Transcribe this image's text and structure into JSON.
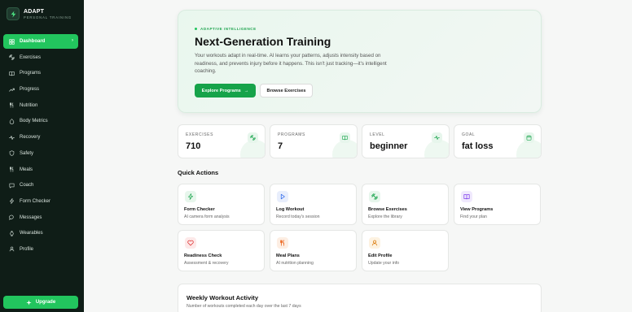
{
  "brand": {
    "name": "ADAPT",
    "subtitle": "PERSONAL TRAINING",
    "logo_icon": "bolt-icon"
  },
  "sidebar": {
    "items": [
      {
        "label": "Dashboard",
        "icon": "grid-icon",
        "active": true
      },
      {
        "label": "Exercises",
        "icon": "dumbbell-icon"
      },
      {
        "label": "Programs",
        "icon": "book-icon"
      },
      {
        "label": "Progress",
        "icon": "trend-icon"
      },
      {
        "label": "Nutrition",
        "icon": "utensils-icon"
      },
      {
        "label": "Body Metrics",
        "icon": "scale-icon"
      },
      {
        "label": "Recovery",
        "icon": "activity-icon"
      },
      {
        "label": "Safety",
        "icon": "shield-icon"
      },
      {
        "label": "Meals",
        "icon": "utensils-icon"
      },
      {
        "label": "Coach",
        "icon": "chat-icon"
      },
      {
        "label": "Form Checker",
        "icon": "bolt-icon"
      },
      {
        "label": "Messages",
        "icon": "message-icon"
      },
      {
        "label": "Wearables",
        "icon": "watch-icon"
      },
      {
        "label": "Profile",
        "icon": "user-icon"
      }
    ],
    "upgrade_label": "Upgrade"
  },
  "hero": {
    "tag": "ADAPTIVE INTELLIGENCE",
    "title": "Next-Generation Training",
    "description": "Your workouts adapt in real-time. AI learns your patterns, adjusts intensity based on readiness, and prevents injury before it happens. This isn't just tracking—it's intelligent coaching.",
    "primary_button": "Explore Programs",
    "primary_arrow": "→",
    "secondary_button": "Browse Exercises"
  },
  "stats": [
    {
      "label": "EXERCISES",
      "value": "710",
      "icon": "dumbbell-icon"
    },
    {
      "label": "PROGRAMS",
      "value": "7",
      "icon": "book-icon"
    },
    {
      "label": "LEVEL",
      "value": "beginner",
      "icon": "activity-icon"
    },
    {
      "label": "GOAL",
      "value": "fat loss",
      "icon": "calendar-icon"
    }
  ],
  "quick_actions": {
    "title": "Quick Actions",
    "items": [
      {
        "title": "Form Checker",
        "subtitle": "AI camera form analysis",
        "icon": "bolt-icon",
        "color": "#16a34a",
        "bg": "#e7f6ec"
      },
      {
        "title": "Log Workout",
        "subtitle": "Record today's session",
        "icon": "play-icon",
        "color": "#2563eb",
        "bg": "#e8eefc"
      },
      {
        "title": "Browse Exercises",
        "subtitle": "Explore the library",
        "icon": "dumbbell-icon",
        "color": "#16a34a",
        "bg": "#e7f6ec"
      },
      {
        "title": "View Programs",
        "subtitle": "Find your plan",
        "icon": "book-icon",
        "color": "#7c3aed",
        "bg": "#f0e9fd"
      },
      {
        "title": "Readiness Check",
        "subtitle": "Assessment & recovery",
        "icon": "heart-icon",
        "color": "#dc2626",
        "bg": "#fde9e9"
      },
      {
        "title": "Meal Plans",
        "subtitle": "AI nutrition planning",
        "icon": "utensils-icon",
        "color": "#ea580c",
        "bg": "#fdeee3"
      },
      {
        "title": "Edit Profile",
        "subtitle": "Update your info",
        "icon": "user-icon",
        "color": "#d97706",
        "bg": "#fdf2e1"
      }
    ]
  },
  "weekly": {
    "title": "Weekly Workout Activity",
    "subtitle": "Number of workouts completed each day over the last 7 days"
  },
  "colors": {
    "accent": "#22c55e",
    "sidebar_bg": "#0f1d17"
  }
}
